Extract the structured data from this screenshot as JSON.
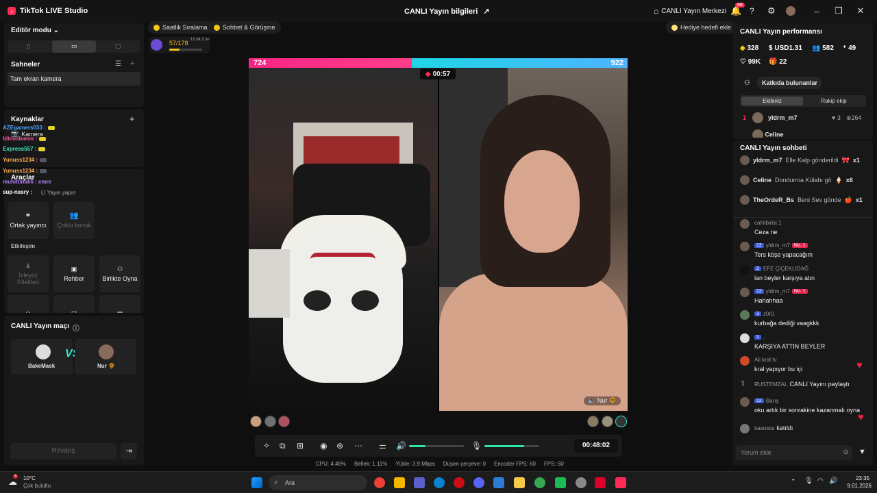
{
  "app": {
    "title": "TikTok LIVE Studio",
    "center_title": "CANLI Yayın bilgileri",
    "live_center": "CANLI Yayın Merkezi",
    "notif_count": "88"
  },
  "left": {
    "editor_mode": "Editör modu",
    "scenes_title": "Sahneler",
    "scene_item": "Tam ekran kamera",
    "sources_title": "Kaynaklar",
    "source_item": "Kamera",
    "tools_title": "Araçlar",
    "tools_sub": "LI Yayın yapın",
    "tile_cohost": "Ortak yayıncı",
    "tile_multi": "Çoklu konuk",
    "interaction_title": "Etkileşim",
    "tile_viewer_wishes": "İzleyici Dilekleri",
    "tile_guide": "Rehber",
    "tile_playtogether": "Birlikte Oyna",
    "match_title": "CANLI Yayın maçı",
    "match_left": "BakeMask",
    "match_right": "Nur 🌻",
    "rematch": "Rövanş"
  },
  "overlay_chat": [
    {
      "name": "AZEgamers033 :",
      "color": "#4ea3ff"
    },
    {
      "name": "bitmisbaros :",
      "color": "#ff5aa5"
    },
    {
      "name": "Express557 :",
      "color": "#3ef0c7"
    },
    {
      "name": "Yunuss1234 :",
      "color": "#ffb04e"
    },
    {
      "name": "Yunuss1234 :",
      "color": "#ffb04e"
    },
    {
      "name": "muhittinak6 : emre",
      "color": "#b57bff"
    },
    {
      "name": "sup-nasry :",
      "color": "#ffffff"
    }
  ],
  "chips": {
    "hourly": "Saatlik Sıralama",
    "chat": "Sohbet & Görüşme",
    "goal": "Hediye hedefi ekle",
    "progress": "57/178",
    "progress_sub": "12 dk 2 sn",
    "progress_value": 0.32
  },
  "battle": {
    "left_score": "724",
    "right_score": "922",
    "timer": "00:57",
    "right_name": "Nur 🌻"
  },
  "controls": {
    "duration": "00:48:02",
    "volume": 0.3,
    "mic": 0.72
  },
  "stats": {
    "cpu": "CPU:  4.46%",
    "memory": "Bellek:  1.11%",
    "upload": "Yükle:  3.9 Mbps",
    "dropped": "Düşen çerçeve:  0",
    "encoder": "Encoder FPS:  60",
    "fps": "FPS:  60"
  },
  "perf": {
    "title": "CANLI Yayın performansı",
    "coins": "328",
    "usd": "USD1.31",
    "viewers": "582",
    "likes_num": "49",
    "hearts": "99K",
    "gifts": "22",
    "contributors": "Katkıda bulunanlar",
    "tab_team": "Ekibiniz",
    "tab_rival": "Rakip ekip",
    "rank1": {
      "rank": "1",
      "name": "yldrm_m7",
      "hearts": "3",
      "coins": "264"
    },
    "rank2": {
      "name": "Celine"
    }
  },
  "chat": {
    "title": "CANLI Yayın sohbeti",
    "gifts": [
      {
        "name": "yldrm_m7",
        "text": "Elle Kalp gönderildi",
        "count": "x1"
      },
      {
        "name": "Celine",
        "text": "Dondurma Külahı gö",
        "count": "x6"
      },
      {
        "name": "TheOrdeR_Bs",
        "text": "Beni Sev gönde",
        "count": "x1"
      }
    ],
    "messages": [
      {
        "name": "cahilbirisi.1",
        "level": "",
        "no1": "",
        "text": "Ceza ne"
      },
      {
        "name": "yldrm_m7",
        "level": "12",
        "no1": "No. 1",
        "text": "Ters köşe yapacağım"
      },
      {
        "name": "EFE ÇİÇEKLİDAĞ",
        "level": "2",
        "no1": "",
        "text": "lan beyler karşıya atın"
      },
      {
        "name": "yldrm_m7",
        "level": "12",
        "no1": "No. 1",
        "text": "Hahahhaa"
      },
      {
        "name": "z0r0.",
        "level": "3",
        "no1": "",
        "text": "kurbağa dediği vaagkkk"
      },
      {
        "name": ".",
        "level": "1",
        "no1": "",
        "text": "KARŞIYA ATTIN BEYLER"
      },
      {
        "name": "Ali kral tv",
        "level": "",
        "no1": "",
        "text": "kral yapıyor bu içi"
      },
      {
        "name": "RUSTEMZAL",
        "level": "",
        "no1": "",
        "text": "CANLI Yayını paylaştı"
      },
      {
        "name": "Barış",
        "level": "12",
        "no1": "",
        "text": "oku artık bir sonrakine kazanmalı oyna"
      },
      {
        "name": "kaansss",
        "level": "",
        "no1": "",
        "text": "katıldı"
      }
    ],
    "placeholder": "Yorum ekle"
  },
  "taskbar": {
    "weather_temp": "10°C",
    "weather_desc": "Çok bulutlu",
    "search": "Ara",
    "time": "23:35",
    "date": "9.01.2026",
    "weather_badge": "6"
  }
}
